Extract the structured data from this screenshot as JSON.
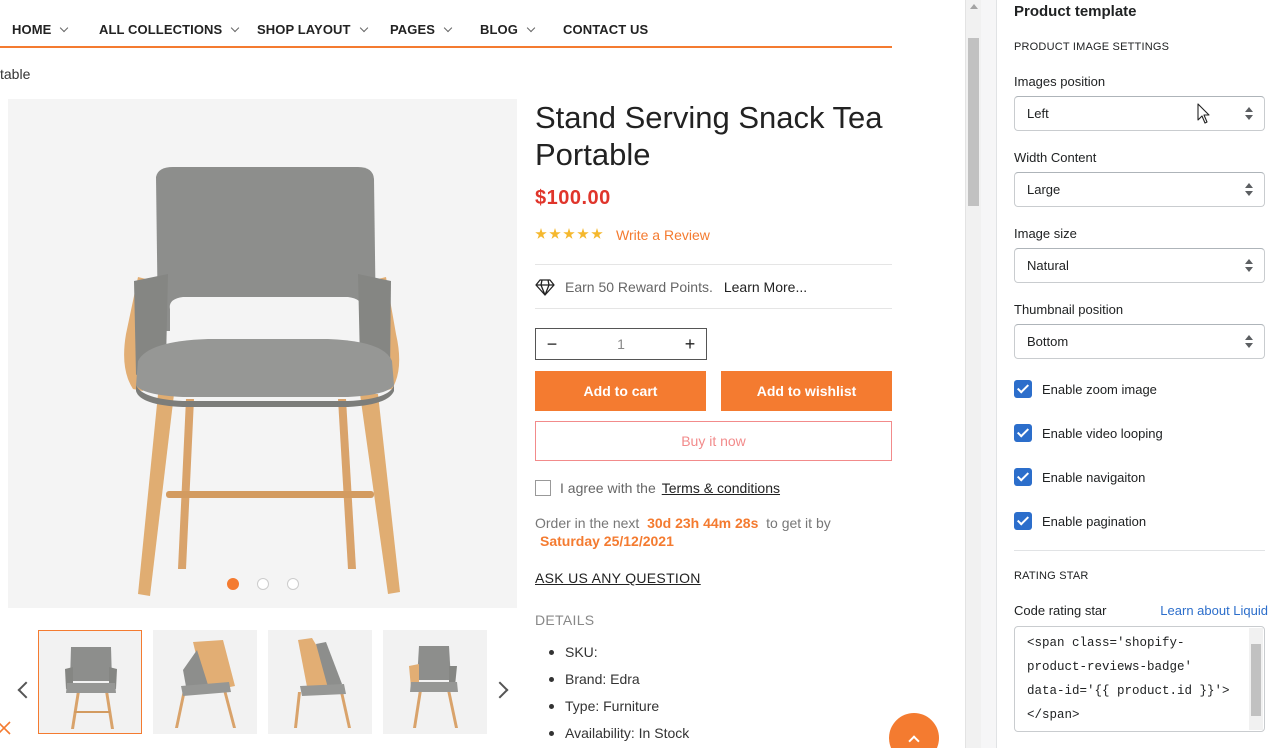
{
  "nav": {
    "items": [
      {
        "label": "HOME",
        "has_dropdown": true
      },
      {
        "label": "ALL COLLECTIONS",
        "has_dropdown": true
      },
      {
        "label": "SHOP LAYOUT",
        "has_dropdown": true
      },
      {
        "label": "PAGES",
        "has_dropdown": true
      },
      {
        "label": "BLOG",
        "has_dropdown": true
      },
      {
        "label": "CONTACT US",
        "has_dropdown": false
      }
    ]
  },
  "breadcrumb": "table",
  "gallery": {
    "dots": 3,
    "active_dot": 1,
    "thumb_count": 4,
    "active_thumb": 1
  },
  "product": {
    "title": "Stand Serving Snack Tea Portable",
    "price": "$100.00",
    "rating_stars": 5,
    "review_link": "Write a Review",
    "reward_text": "Earn 50 Reward Points.",
    "reward_link": "Learn More...",
    "quantity": "1",
    "qty_minus": "−",
    "qty_plus": "+",
    "add_to_cart": "Add to cart",
    "add_to_wishlist": "Add to wishlist",
    "buy_now": "Buy it now",
    "agree_text": "I agree with the",
    "terms_link": "Terms & conditions",
    "order_prefix": "Order in the next",
    "countdown": "30d 23h 44m 28s",
    "order_suffix": "to get it by",
    "delivery_date": "Saturday 25/12/2021",
    "ask_question": "ASK US ANY QUESTION",
    "details_heading": "DETAILS",
    "details": [
      "SKU:",
      "Brand: Edra",
      "Type: Furniture",
      "Availability: In Stock"
    ]
  },
  "panel": {
    "title": "Product template",
    "image_settings_heading": "PRODUCT IMAGE SETTINGS",
    "images_position": {
      "label": "Images position",
      "value": "Left"
    },
    "width_content": {
      "label": "Width Content",
      "value": "Large"
    },
    "image_size": {
      "label": "Image size",
      "value": "Natural"
    },
    "thumbnail_position": {
      "label": "Thumbnail position",
      "value": "Bottom"
    },
    "checkboxes": [
      {
        "label": "Enable zoom image",
        "checked": true
      },
      {
        "label": "Enable video looping",
        "checked": true
      },
      {
        "label": "Enable navigaiton",
        "checked": true
      },
      {
        "label": "Enable pagination",
        "checked": true
      }
    ],
    "rating_heading": "RATING STAR",
    "code_label": "Code rating star",
    "liquid_link": "Learn about Liquid",
    "code_lines": [
      "<span class='shopify-",
      "product-reviews-badge'",
      "data-id='{{ product.id }}'>",
      "</span>"
    ]
  },
  "colors": {
    "accent": "#f47b30",
    "price": "#e0352b",
    "checkbox": "#2c6ecb"
  }
}
